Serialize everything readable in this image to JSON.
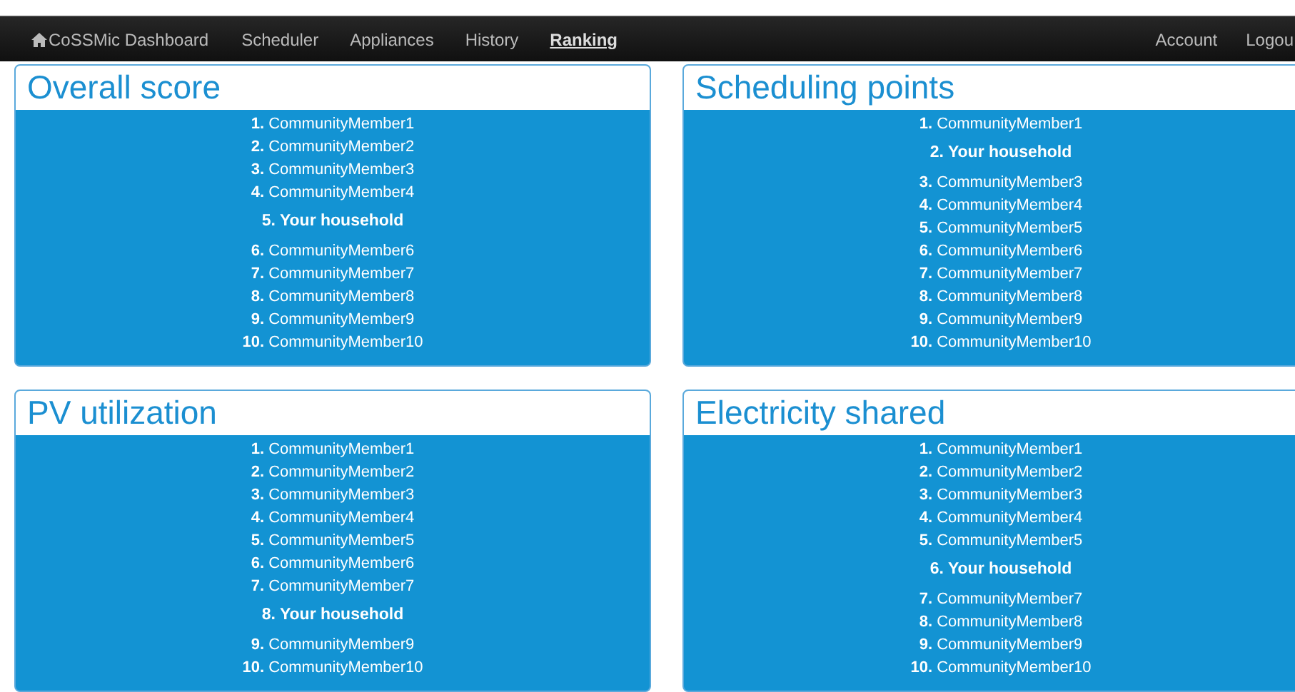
{
  "navbar": {
    "brand": "CoSSMic Dashboard",
    "items": [
      {
        "label": "Scheduler",
        "selected": false
      },
      {
        "label": "Appliances",
        "selected": false
      },
      {
        "label": "History",
        "selected": false
      },
      {
        "label": "Ranking",
        "selected": true
      }
    ],
    "right_items": [
      "Account",
      "Logou"
    ]
  },
  "panels": [
    {
      "title": "Overall score",
      "entries": [
        {
          "kind": "member",
          "rank": "1.",
          "name": "CommunityMember1"
        },
        {
          "kind": "member",
          "rank": "2.",
          "name": "CommunityMember2"
        },
        {
          "kind": "member",
          "rank": "3.",
          "name": "CommunityMember3"
        },
        {
          "kind": "member",
          "rank": "4.",
          "name": "CommunityMember4"
        },
        {
          "kind": "self",
          "rank": "5.",
          "name": "Your household"
        },
        {
          "kind": "member",
          "rank": "6.",
          "name": "CommunityMember6"
        },
        {
          "kind": "member",
          "rank": "7.",
          "name": "CommunityMember7"
        },
        {
          "kind": "member",
          "rank": "8.",
          "name": "CommunityMember8"
        },
        {
          "kind": "member",
          "rank": "9.",
          "name": "CommunityMember9"
        },
        {
          "kind": "member",
          "rank": "10.",
          "name": "CommunityMember10"
        }
      ]
    },
    {
      "title": "Scheduling points",
      "entries": [
        {
          "kind": "member",
          "rank": "1.",
          "name": "CommunityMember1"
        },
        {
          "kind": "self",
          "rank": "2.",
          "name": "Your household"
        },
        {
          "kind": "member",
          "rank": "3.",
          "name": "CommunityMember3"
        },
        {
          "kind": "member",
          "rank": "4.",
          "name": "CommunityMember4"
        },
        {
          "kind": "member",
          "rank": "5.",
          "name": "CommunityMember5"
        },
        {
          "kind": "member",
          "rank": "6.",
          "name": "CommunityMember6"
        },
        {
          "kind": "member",
          "rank": "7.",
          "name": "CommunityMember7"
        },
        {
          "kind": "member",
          "rank": "8.",
          "name": "CommunityMember8"
        },
        {
          "kind": "member",
          "rank": "9.",
          "name": "CommunityMember9"
        },
        {
          "kind": "member",
          "rank": "10.",
          "name": "CommunityMember10"
        }
      ]
    },
    {
      "title": "PV utilization",
      "entries": [
        {
          "kind": "member",
          "rank": "1.",
          "name": "CommunityMember1"
        },
        {
          "kind": "member",
          "rank": "2.",
          "name": "CommunityMember2"
        },
        {
          "kind": "member",
          "rank": "3.",
          "name": "CommunityMember3"
        },
        {
          "kind": "member",
          "rank": "4.",
          "name": "CommunityMember4"
        },
        {
          "kind": "member",
          "rank": "5.",
          "name": "CommunityMember5"
        },
        {
          "kind": "member",
          "rank": "6.",
          "name": "CommunityMember6"
        },
        {
          "kind": "member",
          "rank": "7.",
          "name": "CommunityMember7"
        },
        {
          "kind": "self",
          "rank": "8.",
          "name": "Your household"
        },
        {
          "kind": "member",
          "rank": "9.",
          "name": "CommunityMember9"
        },
        {
          "kind": "member",
          "rank": "10.",
          "name": "CommunityMember10"
        }
      ]
    },
    {
      "title": "Electricity shared",
      "entries": [
        {
          "kind": "member",
          "rank": "1.",
          "name": "CommunityMember1"
        },
        {
          "kind": "member",
          "rank": "2.",
          "name": "CommunityMember2"
        },
        {
          "kind": "member",
          "rank": "3.",
          "name": "CommunityMember3"
        },
        {
          "kind": "member",
          "rank": "4.",
          "name": "CommunityMember4"
        },
        {
          "kind": "member",
          "rank": "5.",
          "name": "CommunityMember5"
        },
        {
          "kind": "self",
          "rank": "6.",
          "name": "Your household"
        },
        {
          "kind": "member",
          "rank": "7.",
          "name": "CommunityMember7"
        },
        {
          "kind": "member",
          "rank": "8.",
          "name": "CommunityMember8"
        },
        {
          "kind": "member",
          "rank": "9.",
          "name": "CommunityMember9"
        },
        {
          "kind": "member",
          "rank": "10.",
          "name": "CommunityMember10"
        }
      ]
    }
  ]
}
